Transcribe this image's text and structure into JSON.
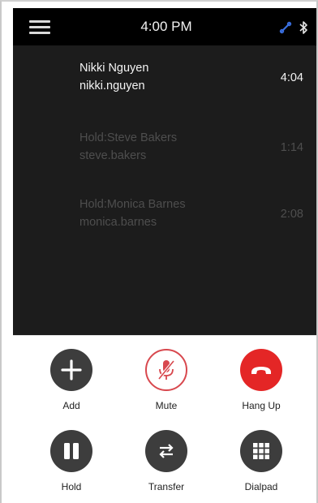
{
  "status_bar": {
    "time": "4:00 PM",
    "icons": [
      "menu-icon",
      "network-link-icon",
      "bluetooth-icon"
    ]
  },
  "calls": [
    {
      "name": "Nikki Nguyen",
      "handle": "nikki.nguyen",
      "duration": "4:04",
      "state": "active"
    },
    {
      "name": "Hold:Steve Bakers",
      "handle": "steve.bakers",
      "duration": "1:14",
      "state": "held"
    },
    {
      "name": "Hold:Monica Barnes",
      "handle": "monica.barnes",
      "duration": "2:08",
      "state": "held"
    }
  ],
  "controls": [
    {
      "label": "Add",
      "icon": "plus-icon"
    },
    {
      "label": "Mute",
      "icon": "microphone-muted-icon"
    },
    {
      "label": "Hang Up",
      "icon": "phone-hangup-icon"
    },
    {
      "label": "Hold",
      "icon": "pause-icon"
    },
    {
      "label": "Transfer",
      "icon": "transfer-arrows-icon"
    },
    {
      "label": "Dialpad",
      "icon": "dialpad-icon"
    }
  ],
  "colors": {
    "status_bar_bg": "#000000",
    "calls_bg": "#1c1c1c",
    "active_text": "#f4f4f4",
    "held_text": "#4e4e4e",
    "control_dark": "#3d3d3d",
    "hangup_red": "#e42626",
    "mute_red": "#d8484e",
    "network_icon_blue": "#3a6fe0"
  }
}
